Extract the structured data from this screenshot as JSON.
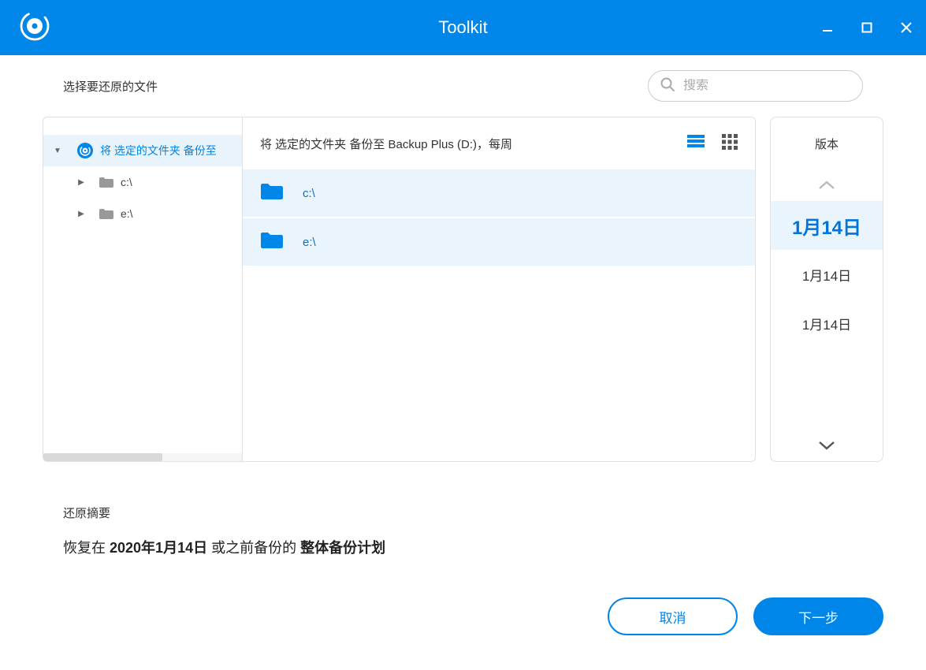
{
  "titlebar": {
    "title": "Toolkit"
  },
  "subheader": {
    "title": "选择要还原的文件"
  },
  "search": {
    "placeholder": "搜索"
  },
  "tree": {
    "items": [
      {
        "label": "将 选定的文件夹 备份至",
        "expanded": true,
        "selected": true,
        "root": true
      },
      {
        "label": "c:\\",
        "expanded": false,
        "selected": false,
        "root": false
      },
      {
        "label": "e:\\",
        "expanded": false,
        "selected": false,
        "root": false
      }
    ]
  },
  "list": {
    "header": "将 选定的文件夹 备份至 Backup Plus (D:)，每周",
    "items": [
      {
        "label": "c:\\"
      },
      {
        "label": "e:\\"
      }
    ]
  },
  "versions": {
    "header": "版本",
    "items": [
      {
        "label": "1月14日",
        "selected": true
      },
      {
        "label": "1月14日",
        "selected": false
      },
      {
        "label": "1月14日",
        "selected": false
      }
    ]
  },
  "summary": {
    "heading": "还原摘要",
    "pre": "恢复在 ",
    "date": "2020年1月14日",
    "mid": " 或之前备份的 ",
    "plan": "整体备份计划"
  },
  "footer": {
    "cancel": "取消",
    "next": "下一步"
  }
}
